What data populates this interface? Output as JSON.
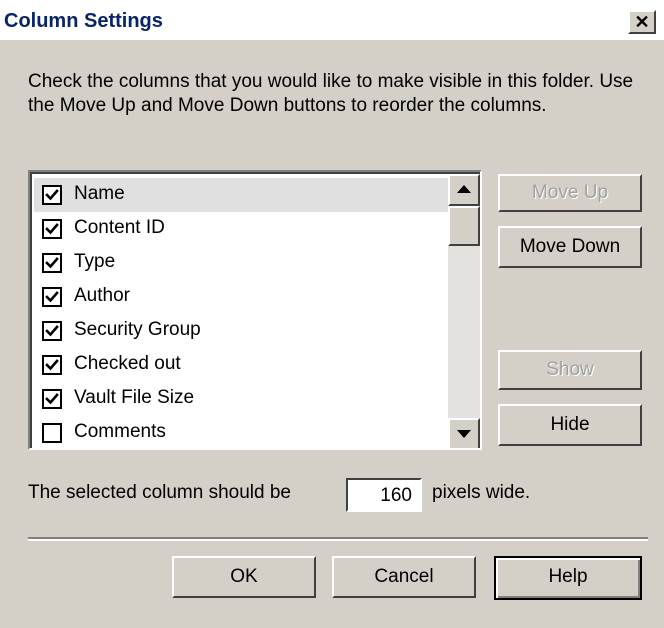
{
  "window": {
    "title": "Column Settings",
    "close_glyph": "✕"
  },
  "description": "Check the columns that you would like to make visible in this folder.  Use the Move Up and Move Down buttons to reorder the columns.",
  "columns": [
    {
      "label": "Name",
      "checked": true,
      "selected": true
    },
    {
      "label": "Content ID",
      "checked": true,
      "selected": false
    },
    {
      "label": "Type",
      "checked": true,
      "selected": false
    },
    {
      "label": "Author",
      "checked": true,
      "selected": false
    },
    {
      "label": "Security Group",
      "checked": true,
      "selected": false
    },
    {
      "label": "Checked out",
      "checked": true,
      "selected": false
    },
    {
      "label": "Vault File Size",
      "checked": true,
      "selected": false
    },
    {
      "label": "Comments",
      "checked": false,
      "selected": false
    }
  ],
  "buttons": {
    "move_up": "Move Up",
    "move_down": "Move Down",
    "show": "Show",
    "hide": "Hide",
    "ok": "OK",
    "cancel": "Cancel",
    "help": "Help"
  },
  "width_setting": {
    "prefix": "The selected column should be",
    "value": "160",
    "suffix": "pixels wide."
  },
  "colors": {
    "title_text": "#0a246a",
    "dialog_face": "#d4d0c8"
  }
}
